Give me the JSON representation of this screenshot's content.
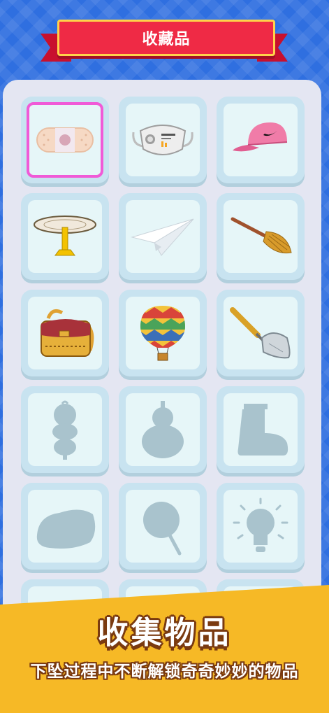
{
  "header": {
    "title": "收藏品"
  },
  "collection": {
    "items": [
      {
        "icon": "bandage-icon",
        "unlocked": true,
        "selected": true
      },
      {
        "icon": "face-mask-icon",
        "unlocked": true,
        "selected": false
      },
      {
        "icon": "cap-icon",
        "unlocked": true,
        "selected": false
      },
      {
        "icon": "gong-icon",
        "unlocked": true,
        "selected": false
      },
      {
        "icon": "paper-plane-icon",
        "unlocked": true,
        "selected": false
      },
      {
        "icon": "broom-icon",
        "unlocked": true,
        "selected": false
      },
      {
        "icon": "backpack-icon",
        "unlocked": true,
        "selected": false
      },
      {
        "icon": "hot-air-balloon-icon",
        "unlocked": true,
        "selected": false
      },
      {
        "icon": "trowel-icon",
        "unlocked": true,
        "selected": false
      },
      {
        "icon": "doll-silhouette-icon",
        "unlocked": false,
        "selected": false
      },
      {
        "icon": "gourd-silhouette-icon",
        "unlocked": false,
        "selected": false
      },
      {
        "icon": "boot-silhouette-icon",
        "unlocked": false,
        "selected": false
      },
      {
        "icon": "rock-silhouette-icon",
        "unlocked": false,
        "selected": false
      },
      {
        "icon": "fan-silhouette-icon",
        "unlocked": false,
        "selected": false
      },
      {
        "icon": "lightbulb-silhouette-icon",
        "unlocked": false,
        "selected": false
      },
      {
        "icon": "locked-item-icon",
        "unlocked": false,
        "selected": false
      },
      {
        "icon": "locked-item-icon",
        "unlocked": false,
        "selected": false
      },
      {
        "icon": "locked-item-icon",
        "unlocked": false,
        "selected": false
      }
    ]
  },
  "footer": {
    "title": "收集物品",
    "subtitle": "下坠过程中不断解锁奇奇妙妙的物品"
  },
  "colors": {
    "background": "#2f6fe0",
    "banner": "#ef2a45",
    "banner_border": "#ffd24a",
    "panel": "#e4e6f2",
    "tile": "#c8e3f0",
    "tile_inner": "#e6f6f8",
    "selected_border": "#f05ad7",
    "footer": "#f6b926",
    "silhouette": "#a9c3cd"
  }
}
